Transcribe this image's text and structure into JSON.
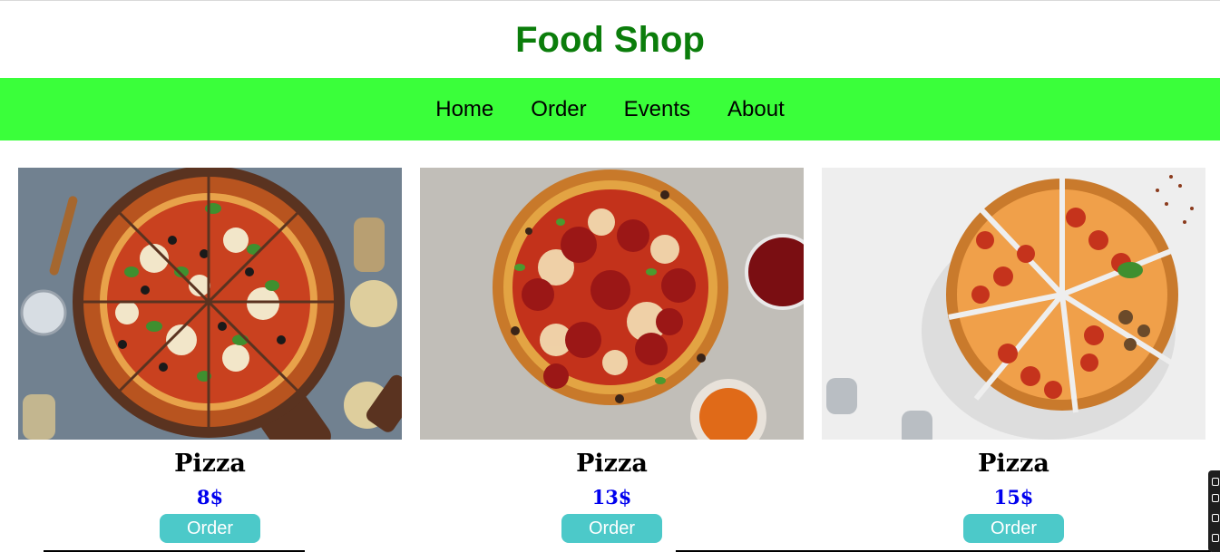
{
  "header": {
    "title": "Food Shop"
  },
  "nav": {
    "items": [
      "Home",
      "Order",
      "Events",
      "About"
    ]
  },
  "products": [
    {
      "name": "Pizza",
      "price": "8$",
      "button_label": "Order",
      "image": "pizza-veggie-board-photo"
    },
    {
      "name": "Pizza",
      "price": "13$",
      "button_label": "Order",
      "image": "pizza-pepperoni-photo"
    },
    {
      "name": "Pizza",
      "price": "15$",
      "button_label": "Order",
      "image": "pizza-sliced-pepperoni-photo"
    }
  ],
  "colors": {
    "title": "#0b7d0b",
    "navbar": "#3aff3a",
    "price": "#0000ee",
    "button": "#4cc9c9"
  }
}
